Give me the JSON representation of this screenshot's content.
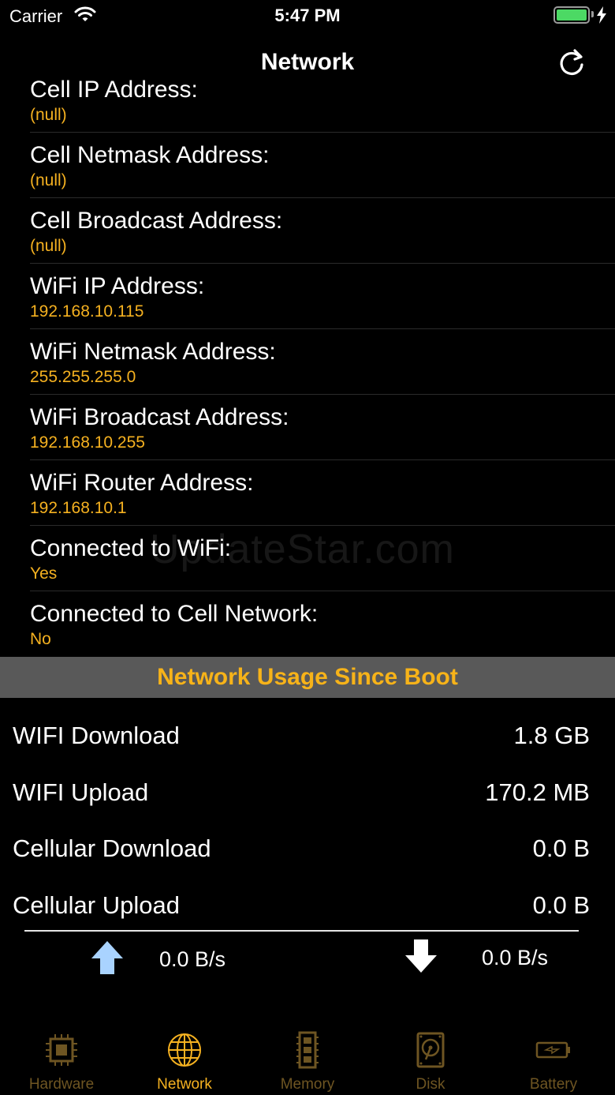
{
  "status_bar": {
    "carrier": "Carrier",
    "time": "5:47 PM",
    "battery_color": "#4cd964"
  },
  "nav": {
    "title": "Network",
    "refresh_icon": "refresh-icon"
  },
  "details": [
    {
      "label": "Cell IP Address:",
      "value": "(null)"
    },
    {
      "label": "Cell Netmask Address:",
      "value": "(null)"
    },
    {
      "label": "Cell Broadcast Address:",
      "value": "(null)"
    },
    {
      "label": "WiFi IP Address:",
      "value": "192.168.10.115"
    },
    {
      "label": "WiFi Netmask Address:",
      "value": "255.255.255.0"
    },
    {
      "label": "WiFi Broadcast Address:",
      "value": "192.168.10.255"
    },
    {
      "label": "WiFi Router Address:",
      "value": "192.168.10.1"
    },
    {
      "label": "Connected to WiFi:",
      "value": "Yes"
    },
    {
      "label": "Connected to Cell Network:",
      "value": "No"
    }
  ],
  "watermark": "UpdateStar.com",
  "usage": {
    "header": "Network Usage Since Boot",
    "rows": [
      {
        "label": "WIFI Download",
        "value": "1.8 GB"
      },
      {
        "label": "WIFI Upload",
        "value": "170.2 MB"
      },
      {
        "label": "Cellular Download",
        "value": "0.0 B"
      },
      {
        "label": "Cellular Upload",
        "value": "0.0 B"
      }
    ],
    "upload_speed": "0.0 B/s",
    "download_speed": "0.0 B/s"
  },
  "tabs": [
    {
      "label": "Hardware",
      "icon": "chip-icon",
      "active": false
    },
    {
      "label": "Network",
      "icon": "globe-icon",
      "active": true
    },
    {
      "label": "Memory",
      "icon": "memory-stick-icon",
      "active": false
    },
    {
      "label": "Disk",
      "icon": "disk-icon",
      "active": false
    },
    {
      "label": "Battery",
      "icon": "battery-icon",
      "active": false
    }
  ],
  "colors": {
    "accent": "#f5b120",
    "section_header_bg": "#595959",
    "inactive_tab": "#6e5522",
    "upload_arrow": "#a9d3ff"
  }
}
